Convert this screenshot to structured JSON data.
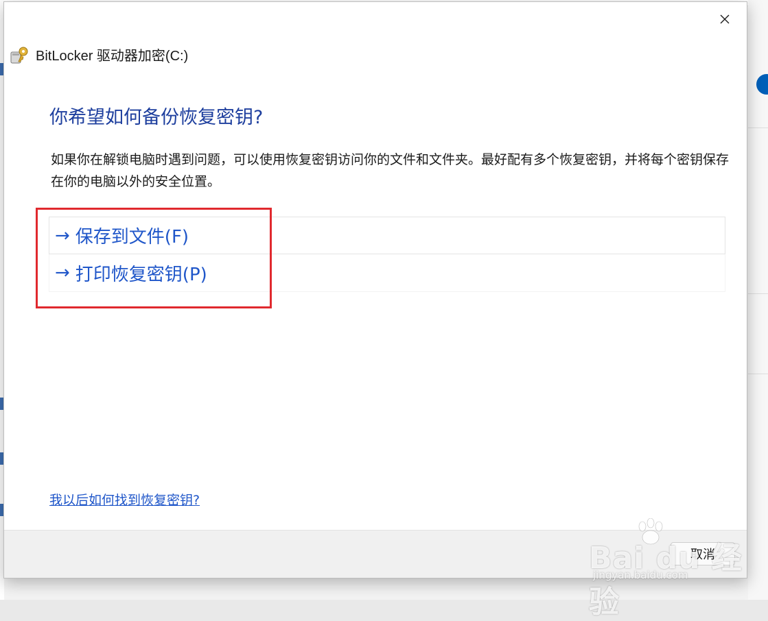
{
  "dialog": {
    "app_title": "BitLocker 驱动器加密(C:)",
    "heading": "你希望如何备份恢复密钥?",
    "description": "如果你在解锁电脑时遇到问题，可以使用恢复密钥访问你的文件和文件夹。最好配有多个恢复密钥，并将每个密钥保存在你的电脑以外的安全位置。",
    "options": [
      {
        "arrow": "→",
        "label": "保存到文件(F)"
      },
      {
        "arrow": "→",
        "label": "打印恢复密钥(P)"
      }
    ],
    "help_link": "我以后如何找到恢复密钥?",
    "cancel_label": "取消"
  },
  "icons": {
    "close": "close-icon",
    "bitlocker": "bitlocker-key-icon"
  },
  "colors": {
    "heading": "#1e3f9e",
    "link": "#1f56c9",
    "highlight": "#e0292e",
    "footer": "#f0f0f0"
  },
  "watermark": {
    "logo": "Bai du 经验",
    "sub": "jingyan.baidu.com"
  }
}
